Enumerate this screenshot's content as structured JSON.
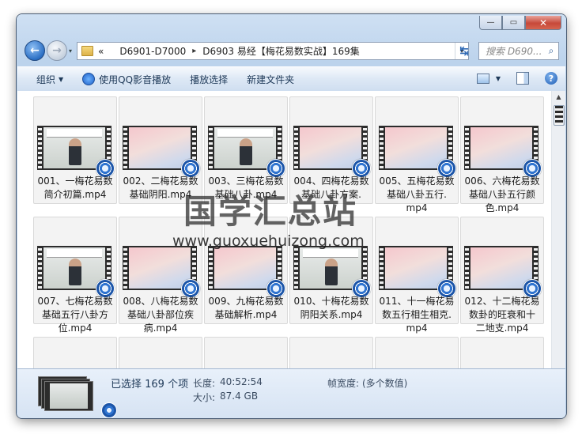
{
  "address": {
    "prefix_glyph": "«",
    "crumbs": [
      "D6901-D7000",
      "D6903 易经【梅花易数实战】169集"
    ],
    "separator_glyph": "▸",
    "dropdown_glyph": "▾"
  },
  "search": {
    "placeholder": "搜索 D690...",
    "icon_glyph": "⌕"
  },
  "nav": {
    "back_glyph": "←",
    "forward_glyph": "→",
    "refresh_glyph": "↹"
  },
  "window_buttons": {
    "min": "—",
    "max": "▭",
    "close": "✕"
  },
  "toolbar": {
    "organize": "组织",
    "play_with_qq": "使用QQ影音播放",
    "play_selection": "播放选择",
    "new_folder": "新建文件夹",
    "help_glyph": "?",
    "dropdown_glyph": "▼"
  },
  "files": [
    {
      "name": "001、一梅花易数简介初篇.mp4",
      "thumb": "lecture"
    },
    {
      "name": "002、二梅花易数基础阴阳.mp4",
      "thumb": "pastel"
    },
    {
      "name": "003、三梅花易数基础八卦.mp4",
      "thumb": "lecture"
    },
    {
      "name": "004、四梅花易数基础八卦方案.",
      "thumb": "pastel"
    },
    {
      "name": "005、五梅花易数基础八卦五行.mp4",
      "thumb": "pastel"
    },
    {
      "name": "006、六梅花易数基础八卦五行颜色.mp4",
      "thumb": "pastel"
    },
    {
      "name": "007、七梅花易数基础五行八卦方位.mp4",
      "thumb": "lecture"
    },
    {
      "name": "008、八梅花易数基础八卦部位疾病.mp4",
      "thumb": "pastel"
    },
    {
      "name": "009、九梅花易数基础解析.mp4",
      "thumb": "pastel"
    },
    {
      "name": "010、十梅花易数阴阳关系.mp4",
      "thumb": "lecture"
    },
    {
      "name": "011、十一梅花易数五行相生相克.mp4",
      "thumb": "pastel"
    },
    {
      "name": "012、十二梅花易数卦的旺衰和十二地支.mp4",
      "thumb": "pastel"
    }
  ],
  "file_labels": [
    [
      "001、一梅花易数",
      "简介初篇.mp4"
    ],
    [
      "002、二梅花易数",
      "基础阴阳.mp4"
    ],
    [
      "003、三梅花易数",
      "基础八卦.mp4"
    ],
    [
      "004、四梅花易数",
      "基础八卦方案."
    ],
    [
      "005、五梅花易数",
      "基础八卦五行.",
      "mp4"
    ],
    [
      "006、六梅花易数",
      "基础八卦五行颜",
      "色.mp4"
    ],
    [
      "007、七梅花易数",
      "基础五行八卦方",
      "位.mp4"
    ],
    [
      "008、八梅花易数",
      "基础八卦部位疾",
      "病.mp4"
    ],
    [
      "009、九梅花易数",
      "基础解析.mp4"
    ],
    [
      "010、十梅花易数",
      "阴阳关系.mp4"
    ],
    [
      "011、十一梅花易",
      "数五行相生相克.",
      "mp4"
    ],
    [
      "012、十二梅花易",
      "数卦的旺衰和十",
      "二地支.mp4"
    ]
  ],
  "status": {
    "selected": "已选择 169 个项",
    "length_label": "长度:",
    "length_value": "40:52:54",
    "size_label": "大小:",
    "size_value": "87.4 GB",
    "frame_width_label": "帧宽度:",
    "frame_width_value": "(多个数值)"
  },
  "watermark": {
    "text": "国学汇总站",
    "url": "www.guoxuehuizong.com"
  },
  "colors": {
    "accent": "#2f74d0",
    "close_button": "#c7493a",
    "chrome": "#bcd3ec"
  }
}
